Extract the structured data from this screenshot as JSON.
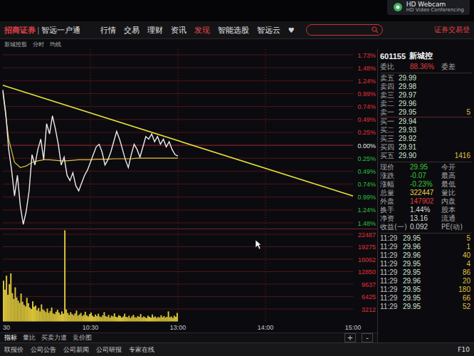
{
  "app": {
    "brand": "招商证券",
    "separator": "|",
    "product": "智远一户通",
    "login": "证券交易登"
  },
  "notification": {
    "title": "HD Webcam",
    "subtitle": "HD Video Conferencing"
  },
  "menu": [
    {
      "label": "行情",
      "selected": false
    },
    {
      "label": "交易",
      "selected": false
    },
    {
      "label": "理财",
      "selected": false
    },
    {
      "label": "资讯",
      "selected": false
    },
    {
      "label": "发现",
      "selected": true
    },
    {
      "label": "智能选股",
      "selected": false
    },
    {
      "label": "智远云",
      "selected": false
    }
  ],
  "menu_more": "♥",
  "subheader": [
    "新城控股",
    "分时",
    "均线"
  ],
  "chart": {
    "price_ticks": [
      {
        "label": "1.73%",
        "color": "#e0303a"
      },
      {
        "label": "1.48%",
        "color": "#e0303a"
      },
      {
        "label": "1.24%",
        "color": "#e0303a"
      },
      {
        "label": "0.99%",
        "color": "#e0303a"
      },
      {
        "label": "0.74%",
        "color": "#e0303a"
      },
      {
        "label": "0.49%",
        "color": "#e0303a"
      },
      {
        "label": "0.25%",
        "color": "#e0303a"
      },
      {
        "label": "0.00%",
        "color": "#e6e6e6"
      },
      {
        "label": "0.25%",
        "color": "#2fbf3f"
      },
      {
        "label": "0.49%",
        "color": "#2fbf3f"
      },
      {
        "label": "0.74%",
        "color": "#2fbf3f"
      },
      {
        "label": "0.99%",
        "color": "#2fbf3f"
      },
      {
        "label": "1.24%",
        "color": "#2fbf3f"
      },
      {
        "label": "1.48%",
        "color": "#2fbf3f"
      }
    ],
    "time_ticks": [
      "30",
      "10:30",
      "13:00",
      "14:00",
      "15:00"
    ],
    "price": [
      1.05,
      0.6,
      -0.1,
      -0.5,
      -1.0,
      -0.6,
      -1.2,
      -1.55,
      -1.3,
      -0.9,
      -0.2,
      -0.4,
      -0.1,
      0.1,
      -0.3,
      0.4,
      0.2,
      0.55,
      0.3,
      0.0,
      -0.4,
      -0.25,
      -0.6,
      -0.7,
      -0.55,
      -0.8,
      -0.9,
      -0.75,
      -0.6,
      -0.5,
      -0.35,
      -0.2,
      -0.05,
      0.0,
      -0.15,
      -0.4,
      -0.3,
      -0.15,
      0.05,
      0.25,
      0.1,
      -0.1,
      -0.3,
      -0.45,
      -0.2,
      0.0,
      -0.1,
      -0.25,
      -0.05,
      0.15,
      0.1,
      0.2,
      0.05,
      0.15,
      0.0,
      0.1,
      -0.05,
      0.05,
      -0.1,
      -0.2,
      -0.23
    ],
    "average": [
      1.0,
      0.1,
      -0.35,
      -0.45,
      -0.42,
      -0.35,
      -0.32,
      -0.3,
      -0.3,
      -0.31,
      -0.32,
      -0.32,
      -0.31,
      -0.3,
      -0.3,
      -0.3,
      -0.29,
      -0.29,
      -0.29,
      -0.28,
      -0.28,
      -0.28,
      -0.28,
      -0.27,
      -0.27,
      -0.27,
      -0.27,
      -0.27,
      -0.27,
      -0.27,
      -0.27
    ],
    "trendline": [
      1.14,
      -1.0
    ],
    "volume": [
      10500,
      8200,
      11800,
      6900,
      9600,
      12400,
      7300,
      5800,
      8800,
      6200,
      5400,
      4800,
      7200,
      5100,
      4300,
      3900,
      6100,
      4700,
      3600,
      3200,
      5200,
      3800,
      4100,
      2900,
      3500,
      2600,
      4400,
      3100,
      2800,
      2400,
      3300,
      2200,
      2700,
      3600,
      2100,
      1900,
      2500,
      3000,
      2300,
      1800,
      2600,
      2000,
      23500,
      3100,
      2200,
      1700,
      2400,
      1900,
      1600,
      2100,
      2800,
      1500,
      1800,
      2200,
      1400,
      1700,
      2500,
      1600,
      1300,
      1900,
      2300,
      1500,
      1200,
      1800,
      1400,
      2000,
      1300,
      1100,
      1600,
      2400,
      1400,
      1200,
      1700,
      1000,
      1500,
      1300,
      2100,
      1200,
      1100,
      1600,
      1400,
      1000,
      1300,
      2000,
      1200,
      1100,
      1500,
      900,
      1300,
      1700,
      1100,
      1000,
      1400,
      1200,
      1900,
      1000,
      1300,
      1100,
      900,
      1500,
      1200,
      1000,
      1800,
      1100,
      1300,
      900,
      1200,
      1000,
      1600,
      1100,
      1400,
      1000,
      1200,
      2600,
      1100,
      1300,
      900,
      1500,
      1200,
      2200
    ],
    "volume_ticks": [
      "22487",
      "19275",
      "16062",
      "12850",
      "9637",
      "6425",
      "3212"
    ]
  },
  "chart_tabs": [
    {
      "label": "指标",
      "selected": true
    },
    {
      "label": "量比",
      "selected": false
    },
    {
      "label": "买卖力道",
      "selected": false
    },
    {
      "label": "竞价图",
      "selected": false
    }
  ],
  "zoom_buttons": [
    "+",
    "-"
  ],
  "quote": {
    "code": "601155",
    "name": "新城控",
    "ratio_label": "委比",
    "ratio": "88.36%",
    "diff_label": "委差",
    "book": [
      {
        "label": "卖五",
        "price": "29.99",
        "volume": ""
      },
      {
        "label": "卖四",
        "price": "29.98",
        "volume": ""
      },
      {
        "label": "卖三",
        "price": "29.97",
        "volume": ""
      },
      {
        "label": "卖二",
        "price": "29.96",
        "volume": ""
      },
      {
        "label": "卖一",
        "price": "29.95",
        "volume": "5"
      },
      {
        "label": "买一",
        "price": "29.94",
        "volume": ""
      },
      {
        "label": "买二",
        "price": "29.93",
        "volume": ""
      },
      {
        "label": "买三",
        "price": "29.92",
        "volume": ""
      },
      {
        "label": "买四",
        "price": "29.91",
        "volume": ""
      },
      {
        "label": "买五",
        "price": "29.90",
        "volume": "1416"
      }
    ],
    "stats": [
      {
        "label": "现价",
        "value": "29.95",
        "label2": "今开",
        "color": "#36c936"
      },
      {
        "label": "涨跌",
        "value": "-0.07",
        "label2": "最高",
        "color": "#36c936"
      },
      {
        "label": "涨幅",
        "value": "-0.23%",
        "label2": "最低",
        "color": "#36c936"
      },
      {
        "label": "总量",
        "value": "322447",
        "label2": "量比",
        "color": "#e8d24a"
      },
      {
        "label": "外盘",
        "value": "147902",
        "label2": "内盘",
        "color": "#e23c3c"
      },
      {
        "label": "换手",
        "value": "1.44%",
        "label2": "股本",
        "color": "#d8d8d8"
      },
      {
        "label": "净资",
        "value": "13.16",
        "label2": "流通",
        "color": "#d8d8d8"
      },
      {
        "label": "收益(一)",
        "value": "0.092",
        "label2": "PE(动)",
        "color": "#d8d8d8"
      }
    ],
    "ticks": [
      {
        "time": "11:29",
        "price": "29.95",
        "volume": "5"
      },
      {
        "time": "11:29",
        "price": "29.96",
        "volume": "1"
      },
      {
        "time": "11:29",
        "price": "29.96",
        "volume": "40"
      },
      {
        "time": "11:29",
        "price": "29.95",
        "volume": "4"
      },
      {
        "time": "11:29",
        "price": "29.95",
        "volume": "86"
      },
      {
        "time": "11:29",
        "price": "29.96",
        "volume": "20"
      },
      {
        "time": "11:29",
        "price": "29.95",
        "volume": "180"
      },
      {
        "time": "11:29",
        "price": "29.95",
        "volume": "66"
      },
      {
        "time": "11:29",
        "price": "29.95",
        "volume": "52"
      }
    ]
  },
  "status_bar": {
    "items": [
      "联报价",
      "公司公告",
      "公司新闻",
      "公司研报",
      "专家在线"
    ],
    "right": [
      "F10"
    ]
  }
}
